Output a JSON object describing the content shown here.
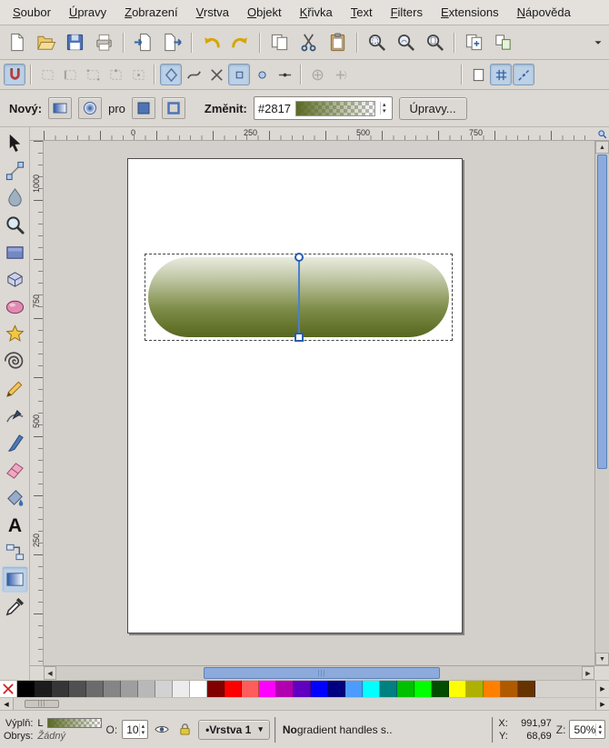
{
  "menu": {
    "items": [
      "Soubor",
      "Úpravy",
      "Zobrazení",
      "Vrstva",
      "Objekt",
      "Křivka",
      "Text",
      "Filters",
      "Extensions",
      "Nápověda"
    ]
  },
  "icons": {
    "command_bar": [
      "new-document",
      "open-document",
      "save-document",
      "print-document",
      "import-document",
      "export-document",
      "undo",
      "redo",
      "copy",
      "cut",
      "paste",
      "zoom-selection",
      "zoom-drawing",
      "zoom-page",
      "duplicate",
      "create-clone",
      "toolbar-overflow"
    ],
    "snap_bar": [
      "enable-snapping",
      "snap-bounding-box",
      "snap-bbox-edges",
      "snap-bbox-corners",
      "snap-bbox-midpoints",
      "snap-bbox-centers",
      "snap-nodes",
      "snap-to-paths",
      "snap-path-intersections",
      "snap-cusp-nodes",
      "snap-smooth-nodes",
      "snap-line-midpoints",
      "snap-object-centers",
      "snap-rotation-centers",
      "snap-page-border",
      "snap-to-grid",
      "snap-to-guides"
    ],
    "toolbox": [
      "selector-tool",
      "node-tool",
      "tweak-tool",
      "zoom-tool",
      "rectangle-tool",
      "box-3d-tool",
      "ellipse-tool",
      "star-tool",
      "spiral-tool",
      "pencil-tool",
      "pen-tool",
      "calligraphy-tool",
      "eraser-tool",
      "paint-bucket-tool",
      "text-tool",
      "connector-tool",
      "gradient-tool",
      "dropper-tool"
    ],
    "active_tool": "gradient-tool"
  },
  "gradient_bar": {
    "new_label": "Nový:",
    "for_label": "pro",
    "change_label": "Změnit:",
    "gradient_id": "#2817",
    "edit_label": "Úpravy..."
  },
  "rulers": {
    "horizontal": [
      "0",
      "250",
      "500",
      "750"
    ],
    "vertical": [
      "1000",
      "750",
      "500",
      "250"
    ]
  },
  "canvas": {
    "shape": "rounded-rectangle-pill",
    "gradient_bottom_color": "#57671f",
    "gradient_top_color": "transparent",
    "handle_color": "#2a5db0"
  },
  "palette": {
    "none_label": "X",
    "colors": [
      "#000000",
      "#1c1c1c",
      "#363636",
      "#505050",
      "#6b6b6b",
      "#858585",
      "#9e9e9e",
      "#b8b8b8",
      "#d2d2d2",
      "#ececec",
      "#ffffff",
      "#800000",
      "#ff0000",
      "#ff5c5c",
      "#ff00ff",
      "#b000b0",
      "#6000c0",
      "#0000ff",
      "#000080",
      "#4d9bff",
      "#00ffff",
      "#008080",
      "#00c000",
      "#00ff00",
      "#004d00",
      "#ffff00",
      "#b0b000",
      "#ff8000",
      "#b05a00",
      "#663300"
    ]
  },
  "status_bar": {
    "fill_label": "Výplň:",
    "fill_type": "L",
    "stroke_label": "Obrys:",
    "stroke_value": "Žádný",
    "opacity_label": "O:",
    "opacity_value": "10",
    "layer_name": "•Vrstva 1",
    "message_bold": "No",
    "message_rest": " gradient handles s..",
    "x_label": "X:",
    "x_value": "991,97",
    "y_label": "Y:",
    "y_value": "68,69",
    "zoom_label": "Z:",
    "zoom_value": "50%"
  }
}
